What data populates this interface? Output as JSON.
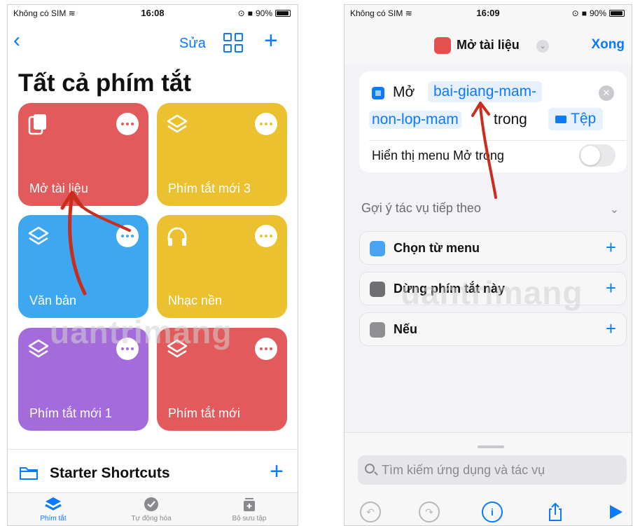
{
  "left": {
    "status": {
      "carrier": "Không có SIM",
      "time": "16:08",
      "battery": "90%"
    },
    "nav": {
      "edit_label": "Sửa"
    },
    "title": "Tất cả phím tắt",
    "tiles": [
      {
        "label": "Mở tài liệu",
        "color": "#e35a5c"
      },
      {
        "label": "Phím tắt mới 3",
        "color": "#ecc12f"
      },
      {
        "label": "Văn bản",
        "color": "#3ea7f2"
      },
      {
        "label": "Nhạc nền",
        "color": "#ecc12f"
      },
      {
        "label": "Phím tắt mới 1",
        "color": "#a46cdb"
      },
      {
        "label": "Phím tắt mới",
        "color": "#e35a5c"
      }
    ],
    "starter_label": "Starter Shortcuts",
    "tabs": [
      {
        "label": "Phím tắt",
        "active": true
      },
      {
        "label": "Tự động hóa",
        "active": false
      },
      {
        "label": "Bộ sưu tập",
        "active": false
      }
    ]
  },
  "right": {
    "status": {
      "carrier": "Không có SIM",
      "time": "16:09",
      "battery": "90%"
    },
    "header": {
      "title": "Mở tài liệu",
      "done_label": "Xong"
    },
    "action": {
      "verb": "Mở",
      "file_line1": "bai-giang-mam-",
      "file_line2": "non-lop-mam",
      "in_word": "trong",
      "app": "Tệp",
      "menu_label": "Hiển thị menu Mở trong"
    },
    "suggestions": {
      "heading": "Gợi ý tác vụ tiếp theo",
      "items": [
        {
          "label": "Chọn từ menu",
          "color": "#4aa3f2"
        },
        {
          "label": "Dừng phím tắt này",
          "color": "#6e6e73"
        },
        {
          "label": "Nếu",
          "color": "#8e8e93"
        }
      ]
    },
    "search": {
      "placeholder": "Tìm kiếm ứng dụng và tác vụ"
    }
  },
  "watermark": "uantrimang",
  "accent": "#0a7aff",
  "arrow_color": "#c92d1e"
}
